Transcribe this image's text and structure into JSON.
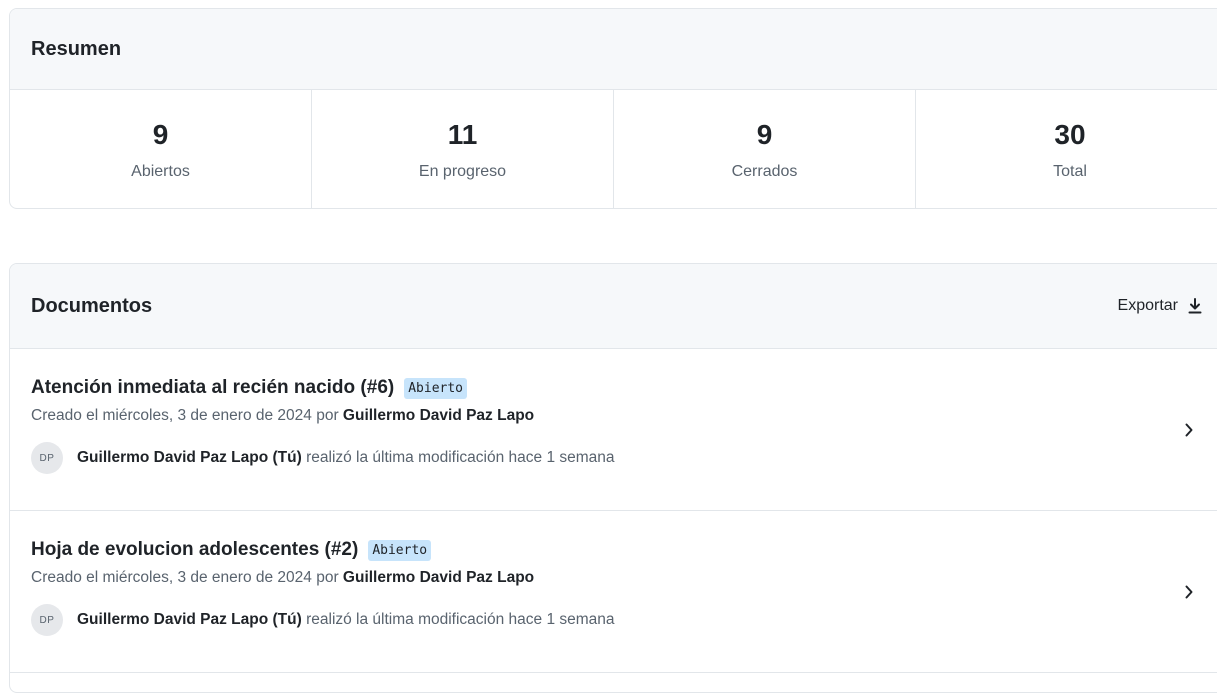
{
  "summary": {
    "title": "Resumen",
    "stats": [
      {
        "value": "9",
        "label": "Abiertos"
      },
      {
        "value": "11",
        "label": "En progreso"
      },
      {
        "value": "9",
        "label": "Cerrados"
      },
      {
        "value": "30",
        "label": "Total"
      }
    ]
  },
  "documents": {
    "title": "Documentos",
    "export_label": "Exportar",
    "items": [
      {
        "title": "Atención inmediata al recién nacido (#6)",
        "status": "Abierto",
        "created_prefix": "Creado el miércoles, 3 de enero de 2024 por",
        "created_by": "Guillermo David Paz Lapo",
        "avatar_initials": "DP",
        "modified_by": "Guillermo David Paz Lapo (Tú)",
        "modified_suffix": "realizó la última modificación hace 1 semana"
      },
      {
        "title": "Hoja de evolucion adolescentes (#2)",
        "status": "Abierto",
        "created_prefix": "Creado el miércoles, 3 de enero de 2024 por",
        "created_by": "Guillermo David Paz Lapo",
        "avatar_initials": "DP",
        "modified_by": "Guillermo David Paz Lapo (Tú)",
        "modified_suffix": "realizó la última modificación hace 1 semana"
      }
    ]
  },
  "colors": {
    "badge_bg": "#c7e4fb",
    "header_bg": "#f6f8fa",
    "border": "#e2e6ea"
  }
}
